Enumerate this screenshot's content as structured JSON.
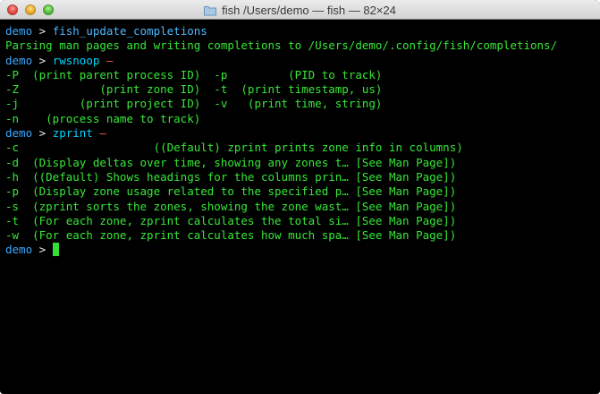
{
  "window": {
    "title": "fish  /Users/demo — fish — 82×24"
  },
  "terminal": {
    "prompt_user": "demo",
    "prompt_sep": ">",
    "cmd1": "fish_update_completions",
    "out1": "Parsing man pages and writing completions to /Users/demo/.config/fish/completions/",
    "cmd2": "rwsnoop",
    "cmd2_suffix": " –",
    "rwsnoop_lines": [
      "-P  (print parent process ID)  -p         (PID to track)",
      "-Z            (print zone ID)  -t  (print timestamp, us)",
      "-j         (print project ID)  -v   (print time, string)",
      "-n    (process name to track)"
    ],
    "cmd3": "zprint",
    "cmd3_suffix": " –",
    "zprint_lines": [
      "-c                    ((Default) zprint prints zone info in columns)",
      "-d  (Display deltas over time, showing any zones t… [See Man Page])",
      "-h  ((Default) Shows headings for the columns prin… [See Man Page])",
      "-p  (Display zone usage related to the specified p… [See Man Page])",
      "-s  (zprint sorts the zones, showing the zone wast… [See Man Page])",
      "-t  (For each zone, zprint calculates the total si… [See Man Page])",
      "-w  (For each zone, zprint calculates how much spa… [See Man Page])"
    ]
  }
}
